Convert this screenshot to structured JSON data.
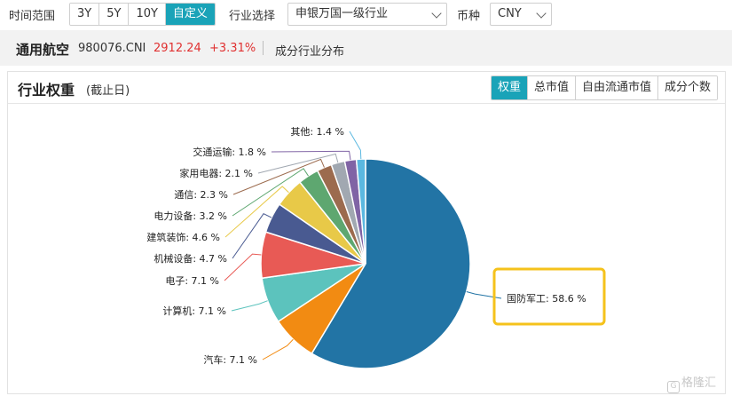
{
  "filters": {
    "time_range_label": "时间范围",
    "time_ranges": [
      "3Y",
      "5Y",
      "10Y",
      "自定义"
    ],
    "active_time_range": "自定义",
    "industry_label": "行业选择",
    "industry_value": "申银万国一级行业",
    "currency_label": "币种",
    "currency_value": "CNY"
  },
  "stock": {
    "name": "通用航空",
    "code": "980076.CNI",
    "price": "2912.24",
    "change": "+3.31%",
    "link": "成分行业分布"
  },
  "card": {
    "title": "行业权重",
    "subtitle": "(截止日)",
    "tabs": [
      "权重",
      "总市值",
      "自由流通市值",
      "成分个数"
    ],
    "active_tab": "权重"
  },
  "watermark": "格隆汇",
  "chart_data": {
    "type": "pie",
    "title": "",
    "slices": [
      {
        "label": "国防军工",
        "value": 58.6,
        "text": "国防军工: 58.6 %",
        "color": "#2274a5"
      },
      {
        "label": "汽车",
        "value": 7.1,
        "text": "汽车: 7.1 %",
        "color": "#f28b12"
      },
      {
        "label": "计算机",
        "value": 7.1,
        "text": "计算机: 7.1 %",
        "color": "#5cc3bd"
      },
      {
        "label": "电子",
        "value": 7.1,
        "text": "电子: 7.1 %",
        "color": "#e85a55"
      },
      {
        "label": "机械设备",
        "value": 4.7,
        "text": "机械设备: 4.7 %",
        "color": "#495a91"
      },
      {
        "label": "建筑装饰",
        "value": 4.6,
        "text": "建筑装饰: 4.6 %",
        "color": "#e8c948"
      },
      {
        "label": "电力设备",
        "value": 3.2,
        "text": "电力设备: 3.2 %",
        "color": "#5ea770"
      },
      {
        "label": "通信",
        "value": 2.3,
        "text": "通信: 2.3 %",
        "color": "#9c6b4e"
      },
      {
        "label": "家用电器",
        "value": 2.1,
        "text": "家用电器: 2.1 %",
        "color": "#a1a8b1"
      },
      {
        "label": "交通运输",
        "value": 1.8,
        "text": "交通运输: 1.8 %",
        "color": "#8064a5"
      },
      {
        "label": "其他",
        "value": 1.4,
        "text": "其他: 1.4 %",
        "color": "#5bb8e0"
      }
    ],
    "highlighted": "国防军工",
    "highlight_color": "#f5c21b",
    "legend": "none"
  }
}
